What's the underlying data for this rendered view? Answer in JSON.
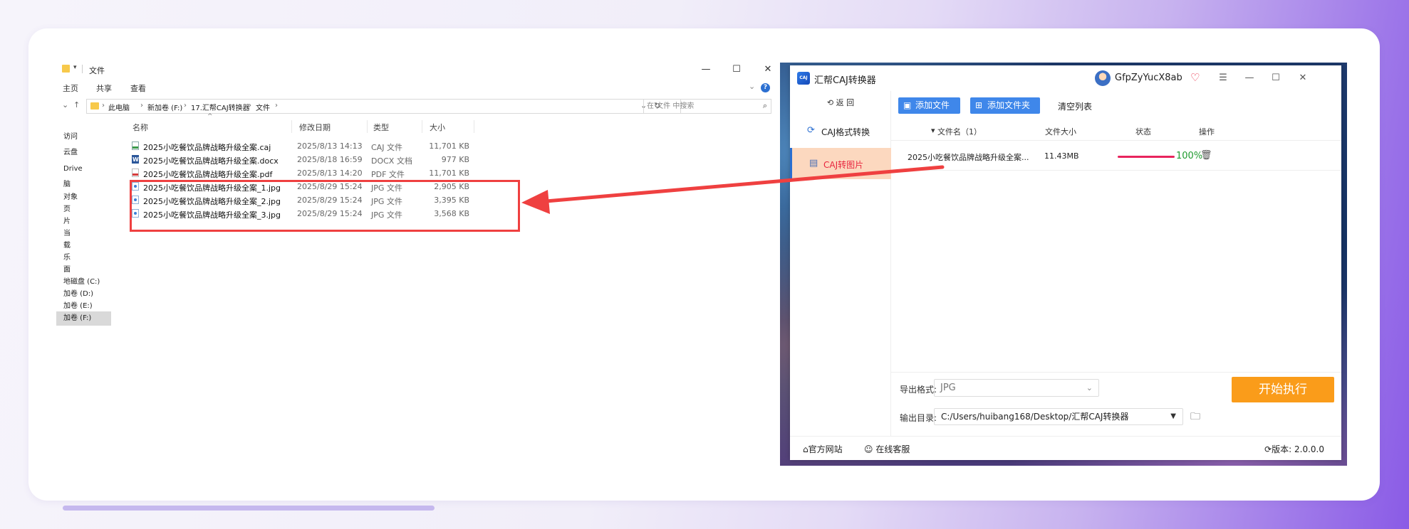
{
  "explorer": {
    "title": "文件",
    "window_buttons": {
      "minimize": "—",
      "maximize": "☐",
      "close": "✕"
    },
    "ribbon": {
      "tab_home": "主页",
      "tab_share": "共享",
      "tab_view": "查看",
      "help": "?"
    },
    "breadcrumb": [
      "此电脑",
      "新加卷 (F:)",
      "17.汇帮CAJ转换器",
      "文件"
    ],
    "search_placeholder": "在 文件 中搜索",
    "nav_items": [
      "访问",
      "云盘",
      "Drive",
      "脑",
      "对象",
      "页",
      "片",
      "当",
      "载",
      "乐",
      "面",
      "地磁盘 (C:)",
      "加卷 (D:)",
      "加卷 (E:)",
      "加卷 (F:)"
    ],
    "columns": {
      "name": "名称",
      "date": "修改日期",
      "type": "类型",
      "size": "大小"
    },
    "files": [
      {
        "name": "2025小吃餐饮品牌战略升级全案.caj",
        "date": "2025/8/13 14:13",
        "type": "CAJ 文件",
        "size": "11,701 KB",
        "icon": "caj-file-icon"
      },
      {
        "name": "2025小吃餐饮品牌战略升级全案.docx",
        "date": "2025/8/18 16:59",
        "type": "DOCX 文档",
        "size": "977 KB",
        "icon": "word-file-icon"
      },
      {
        "name": "2025小吃餐饮品牌战略升级全案.pdf",
        "date": "2025/8/13 14:20",
        "type": "PDF 文件",
        "size": "11,701 KB",
        "icon": "pdf-file-icon"
      },
      {
        "name": "2025小吃餐饮品牌战略升级全案_1.jpg",
        "date": "2025/8/29 15:24",
        "type": "JPG 文件",
        "size": "2,905 KB",
        "icon": "jpg-file-icon"
      },
      {
        "name": "2025小吃餐饮品牌战略升级全案_2.jpg",
        "date": "2025/8/29 15:24",
        "type": "JPG 文件",
        "size": "3,395 KB",
        "icon": "jpg-file-icon"
      },
      {
        "name": "2025小吃餐饮品牌战略升级全案_3.jpg",
        "date": "2025/8/29 15:24",
        "type": "JPG 文件",
        "size": "3,568 KB",
        "icon": "jpg-file-icon"
      }
    ]
  },
  "app": {
    "logo_text": "CAJ",
    "name": "汇帮CAJ转换器",
    "username": "GfpZyYucX8ab",
    "window_buttons": {
      "menu": "☰",
      "minimize": "—",
      "maximize": "☐",
      "close": "✕"
    },
    "back_label": "返  回",
    "sidebar": [
      {
        "label": "CAJ格式转换",
        "icon": "refresh-icon"
      },
      {
        "label": "CAJ转图片",
        "icon": "document-icon"
      }
    ],
    "toolbar": {
      "add_file": "添加文件",
      "add_folder": "添加文件夹",
      "clear_list": "清空列表"
    },
    "table_headers": {
      "filename": "文件名（1）",
      "filesize": "文件大小",
      "status": "状态",
      "action": "操作"
    },
    "rows": [
      {
        "filename": "2025小吃餐饮品牌战略升级全案...",
        "filesize": "11.43MB",
        "progress": 100,
        "progress_text": "100%"
      }
    ],
    "export_format_label": "导出格式:",
    "export_format_value": "JPG",
    "output_dir_label": "输出目录:",
    "output_dir_value": "C:/Users/huibang168/Desktop/汇帮CAJ转换器",
    "start_button": "开始执行",
    "footer": {
      "website": "官方网站",
      "support": "在线客服",
      "version_label": "版本:",
      "version": "2.0.0.0"
    }
  },
  "colors": {
    "highlight_box": "#ef4040",
    "arrow": "#ef4040",
    "primary_button": "#3f87ea",
    "start_button": "#fa9c1a",
    "active_sidebar": "#fcd8bf",
    "progress_bar": "#e8245d",
    "progress_text": "#1f9b2f"
  }
}
